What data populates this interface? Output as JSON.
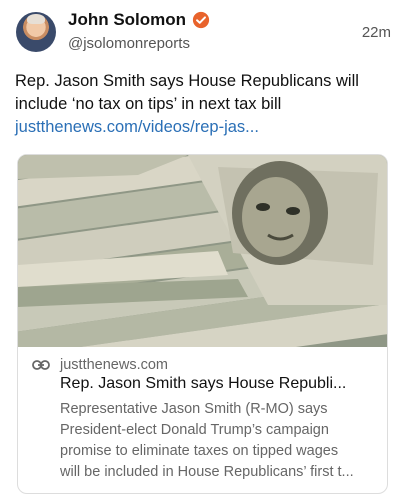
{
  "post": {
    "author_name": "John Solomon",
    "handle": "@jsolomonreports",
    "timestamp": "22m",
    "text": "Rep. Jason Smith says House Republicans will include ‘no tax on tips’ in next tax bill",
    "link_text": "justthenews.com/videos/rep-jas..."
  },
  "card": {
    "domain": "justthenews.com",
    "title": "Rep. Jason Smith says House Republi...",
    "description_lines": [
      "Representative Jason Smith (R-MO) says",
      "President-elect Donald Trump’s campaign",
      "promise to eliminate taxes on tipped wages",
      "will be included in House Republicans’ first t..."
    ]
  },
  "icons": {
    "verified": "verified-badge-icon",
    "link": "link-icon"
  },
  "colors": {
    "link": "#2a6fb6",
    "verified_badge": "#e8632c"
  }
}
